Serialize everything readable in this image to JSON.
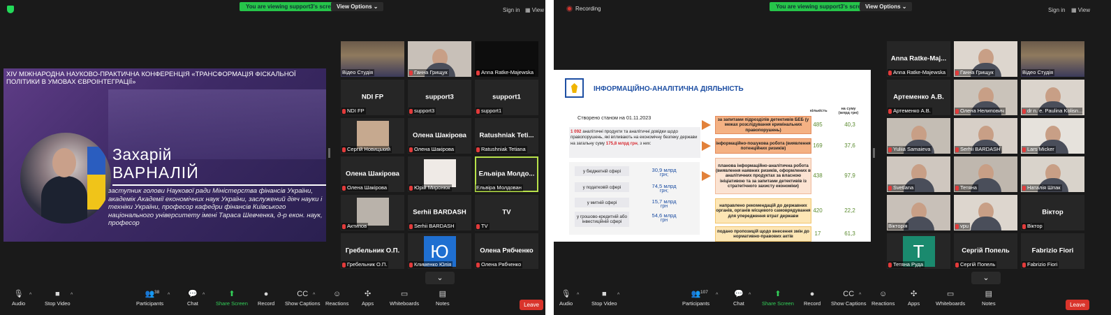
{
  "left": {
    "viewing": "You are viewing support3's screen",
    "view_options": "View Options",
    "sign_in": "Sign in",
    "view": "View",
    "slide": {
      "conference": "XIV МІЖНАРОДНА НАУКОВО-ПРАКТИЧНА КОНФЕРЕНЦІЯ «ТРАНСФОРМАЦІЯ ФІСКАЛЬНОЇ ПОЛІТИКИ В УМОВАХ ЄВРОІНТЕГРАЦІЇ»",
      "first_name": "Захарій",
      "last_name": "ВАРНАЛІЙ",
      "description": "заступник голови Наукової ради Міністерства фінансів України, академік Академії економічних наук України, заслужений діяч науки і техніки України, професор кафедри фінансів Київського національного університету імені Тараса Шевченка, д-р екон. наук, професор"
    },
    "tiles": [
      {
        "center": "",
        "label": "Відео Студія",
        "kind": "video-hall",
        "mic": false
      },
      {
        "center": "",
        "label": "Ганна Грищук",
        "kind": "video-face",
        "mic": true
      },
      {
        "center": "",
        "label": "Anna Ratke-Majewska",
        "kind": "black",
        "mic": true
      },
      {
        "center": "NDI FP",
        "label": "NDI FP",
        "kind": "name",
        "mic": true
      },
      {
        "center": "support3",
        "label": "support3",
        "kind": "name",
        "mic": true
      },
      {
        "center": "support1",
        "label": "support1",
        "kind": "name",
        "mic": true
      },
      {
        "center": "",
        "label": "Сергій Новицький",
        "kind": "photo",
        "mic": true
      },
      {
        "center": "Олена Шакірова",
        "label": "Олена Шакірова",
        "kind": "name",
        "mic": true
      },
      {
        "center": "Ratushniak Teti...",
        "label": "Ratushniak Tetiana",
        "kind": "name",
        "mic": true
      },
      {
        "center": "Олена Шакірова",
        "label": "Олена Шакірова",
        "kind": "name",
        "mic": true
      },
      {
        "center": "",
        "label": "Юрій Миронюк",
        "kind": "photo2",
        "mic": true
      },
      {
        "center": "Ельвіра Молдо...",
        "label": "Ельвіра Молдован",
        "kind": "name",
        "mic": false,
        "active": true
      },
      {
        "center": "",
        "label": "Актипов",
        "kind": "photo3",
        "mic": true
      },
      {
        "center": "Serhii BARDASH",
        "label": "Serhii BARDASH",
        "kind": "name",
        "mic": true
      },
      {
        "center": "TV",
        "label": "TV",
        "kind": "name",
        "mic": true
      },
      {
        "center": "Гребельник О.П.",
        "label": "Гребельник О.П.",
        "kind": "name",
        "mic": true
      },
      {
        "center": "Ю",
        "label": "Клименко Юлія",
        "kind": "avatar-blue",
        "mic": true
      },
      {
        "center": "Олена Рябченко",
        "label": "Олена Рябченко",
        "kind": "name",
        "mic": true
      }
    ],
    "toolbar": {
      "audio": "Audio",
      "stop_video": "Stop Video",
      "participants": "Participants",
      "participants_count": "38",
      "chat": "Chat",
      "share_screen": "Share Screen",
      "record": "Record",
      "captions": "Show Captions",
      "reactions": "Reactions",
      "apps": "Apps",
      "whiteboards": "Whiteboards",
      "notes": "Notes",
      "leave": "Leave"
    }
  },
  "right": {
    "recording": "Recording",
    "viewing": "You are viewing support3's screen",
    "view_options": "View Options",
    "sign_in": "Sign in",
    "view": "View",
    "slide": {
      "title": "ІНФОРМАЦІЙНО-АНАЛІТИЧНА ДІЯЛЬНІСТЬ",
      "as_of": "Створено станом на 01.11.2023",
      "col_count": "кількість",
      "col_sum": "на суму (млрд грн)",
      "summary_pre": "",
      "summary_count": "1 092",
      "summary_mid": " аналітичні продукти та аналітичні довідки щодо правопорушень, які впливають на економічну безпеку  держави на загальну суму ",
      "summary_amount": "175,8 млрд грн",
      "summary_post": ", з них:",
      "spheres": [
        {
          "label": "у бюджетній сфері",
          "value": "30,9 млрд",
          "unit": "грн;"
        },
        {
          "label": "у податковій сфері",
          "value": "74,5 млрд",
          "unit": "грн;"
        },
        {
          "label": "у митній сфері",
          "value": "15,7 млрд",
          "unit": "грн"
        },
        {
          "label": "у грошово-кредитній або інвестиційній сфері",
          "value": "54,6 млрд",
          "unit": "грн"
        }
      ],
      "rows": [
        {
          "text": "за запитами підрозділів детективів БЕБ (у межах розслідування кримінальних правопорушень)",
          "count": "485",
          "sum": "40,3"
        },
        {
          "text": "інформаційно-пошукова робота (виявлення потенційних ризиків)",
          "count": "169",
          "sum": "37,6"
        },
        {
          "text": "планова інформаційно-аналітична робота (виявлення наявних ризиків, оформлених в аналітичних продуктах за власною ініціативою та за запитами детективів із стратегічного захисту економіки)",
          "count": "438",
          "sum": "97,9"
        },
        {
          "text": "направлено рекомендацій до державних органів, органів місцевого самоврядування для упередження втрат держави",
          "count": "420",
          "sum": "22,2"
        },
        {
          "text": "подано пропозицій щодо внесення змін до нормативно-правових актів",
          "count": "17",
          "sum": "61,3"
        }
      ]
    },
    "tiles": [
      {
        "center": "Anna Ratke-Maj...",
        "label": "Anna Ratke-Majewska",
        "kind": "name",
        "mic": true
      },
      {
        "center": "",
        "label": "Ганна Грищук",
        "kind": "video-face",
        "mic": true
      },
      {
        "center": "",
        "label": "Відео Студія",
        "kind": "video-hall",
        "mic": false,
        "active": true
      },
      {
        "center": "Артеменко А.В.",
        "label": "Артеменко А.В.",
        "kind": "name",
        "mic": true
      },
      {
        "center": "",
        "label": "Олена Нелипович",
        "kind": "video-face2",
        "mic": true
      },
      {
        "center": "",
        "label": "dr n. e. Paulina Kolisn...",
        "kind": "video-face3",
        "mic": true
      },
      {
        "center": "",
        "label": "Yuliia Samaieva",
        "kind": "video-face4",
        "mic": true
      },
      {
        "center": "",
        "label": "Serhii BARDASH",
        "kind": "video-face5",
        "mic": true
      },
      {
        "center": "",
        "label": "Lars Micker",
        "kind": "video-face6",
        "mic": true
      },
      {
        "center": "",
        "label": "Svetlana",
        "kind": "video-face7",
        "mic": true
      },
      {
        "center": "",
        "label": "Тетяна",
        "kind": "video-face8",
        "mic": true
      },
      {
        "center": "",
        "label": "Наталія Шпак",
        "kind": "video-face9",
        "mic": true
      },
      {
        "center": "",
        "label": "Вікторія",
        "kind": "video-face10",
        "mic": false
      },
      {
        "center": "",
        "label": "vpu",
        "kind": "video-face11",
        "mic": true
      },
      {
        "center": "Віктор",
        "label": "Віктор",
        "kind": "name",
        "mic": true
      },
      {
        "center": "T",
        "label": "Тетяна Руда",
        "kind": "avatar-teal",
        "mic": true
      },
      {
        "center": "Сергій Попель",
        "label": "Сергій Попель",
        "kind": "name",
        "mic": true
      },
      {
        "center": "Fabrizio Fiori",
        "label": "Fabrizio Fiori",
        "kind": "name",
        "mic": true
      }
    ],
    "toolbar": {
      "audio": "Audio",
      "stop_video": "Stop Video",
      "participants": "Participants",
      "participants_count": "107",
      "chat": "Chat",
      "share_screen": "Share Screen",
      "record": "Record",
      "captions": "Show Captions",
      "reactions": "Reactions",
      "apps": "Apps",
      "whiteboards": "Whiteboards",
      "notes": "Notes",
      "leave": "Leave"
    }
  }
}
